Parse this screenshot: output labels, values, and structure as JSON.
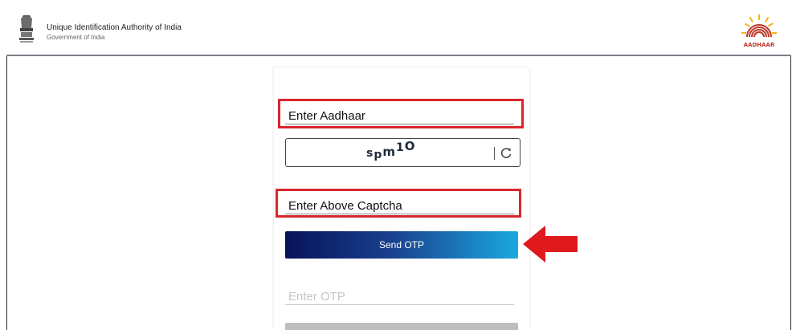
{
  "header": {
    "org_name": "Unique Identification Authority of India",
    "gov_name": "Government of India",
    "emblem_icon": "national-emblem-icon",
    "logo_icon": "aadhaar-logo-icon",
    "logo_text": "AADHAAR"
  },
  "form": {
    "aadhaar_field": {
      "value": "Enter Aadhaar"
    },
    "captcha": {
      "text": "spm1O",
      "refresh_icon": "refresh-icon"
    },
    "captcha_field": {
      "value": "Enter Above Captcha"
    },
    "send_otp_label": "Send OTP",
    "otp_field": {
      "placeholder": "Enter OTP"
    },
    "highlight_color": "#d9262c",
    "arrow_color": "#e0191f"
  }
}
